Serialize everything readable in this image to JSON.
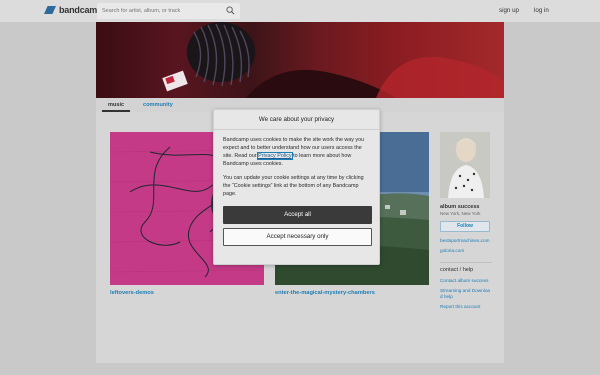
{
  "header": {
    "logo_text": "bandcamp",
    "search_placeholder": "Search for artist, album, or track",
    "signup_label": "sign up",
    "login_label": "log in"
  },
  "tabs": {
    "music": "music",
    "community": "community"
  },
  "albums": [
    {
      "title": "leftovers-demos"
    },
    {
      "title": "enter-the-magical-mystery-chambers"
    }
  ],
  "sidebar": {
    "band_name": "album success",
    "location": "New York, New York",
    "follow_label": "Follow",
    "links": [
      "bestsportmachines.com",
      "goloria.com"
    ],
    "contact_heading": "contact / help",
    "contact_links": [
      "Contact album success",
      "Streaming and Download help",
      "Report this account"
    ]
  },
  "modal": {
    "title": "We care about your privacy",
    "p1_before": "Bandcamp uses cookies to make the site work the way you expect and to better understand how our users access the site. Read our ",
    "p1_link": "Privacy Policy",
    "p1_after": " to learn more about how Bandcamp uses cookies.",
    "p2": "You can update your cookie settings at any time by clicking the “Cookie settings” link at the bottom of any Bandcamp page.",
    "accept_all": "Accept all",
    "accept_necessary": "Accept necessary only"
  },
  "colors": {
    "link_blue": "#1e7db4",
    "accept_button": "#3a3a3a",
    "banner_red": "#8c1d22"
  }
}
